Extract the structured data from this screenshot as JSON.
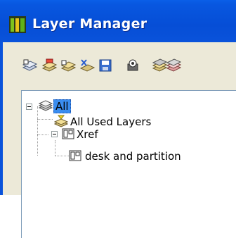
{
  "window": {
    "title": "Layer Manager"
  },
  "toolbar": {
    "buttons": [
      {
        "name": "new-layer-icon"
      },
      {
        "name": "new-layer-filter-icon"
      },
      {
        "name": "layer-state-icon"
      },
      {
        "name": "delete-layer-icon"
      },
      {
        "name": "save-icon"
      },
      {
        "name": "display-settings-icon"
      },
      {
        "name": "layer-stack-icon"
      },
      {
        "name": "layer-stack-alt-icon"
      }
    ]
  },
  "tree": {
    "nodes": [
      {
        "label": "All",
        "selected": true
      },
      {
        "label": "All Used Layers"
      },
      {
        "label": "Xref"
      },
      {
        "label": "desk and partition"
      }
    ]
  }
}
